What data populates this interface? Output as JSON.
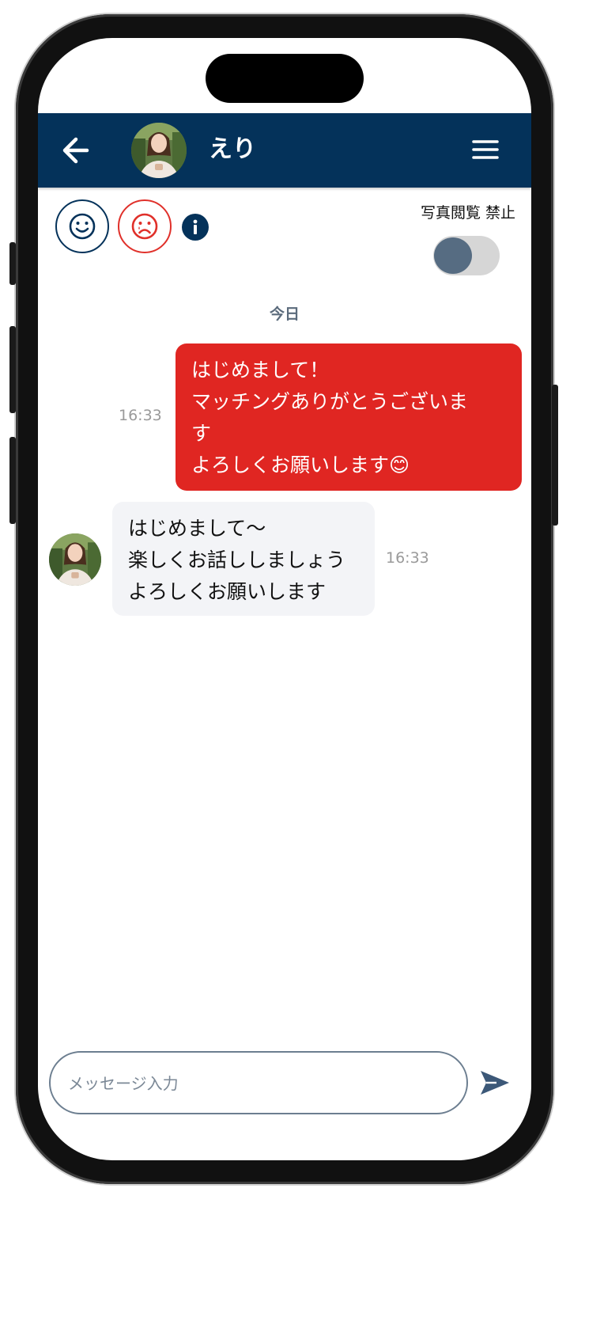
{
  "header": {
    "name": "えり",
    "back_icon": "arrow-left-icon",
    "menu_icon": "hamburger-menu-icon",
    "avatar": "profile-photo"
  },
  "toolbar": {
    "like_icon": "smile-face-icon",
    "dislike_icon": "sad-face-icon",
    "info_icon": "info-icon",
    "photo_view_label": "写真閲覧 禁止",
    "photo_view_forbidden": false
  },
  "chat": {
    "date_separator": "今日",
    "messages": [
      {
        "direction": "outgoing",
        "text": "はじめまして！\nマッチングありがとうございま\nす\nよろしくお願いします😊",
        "time": "16:33"
      },
      {
        "direction": "incoming",
        "text": "はじめまして〜\n楽しくお話ししましょう\nよろしくお願いします",
        "time": "16:33"
      }
    ]
  },
  "composer": {
    "placeholder": "メッセージ入力",
    "value": "",
    "send_icon": "send-icon"
  },
  "colors": {
    "navy": "#04325a",
    "red": "#e02622",
    "incoming_bubble": "#f3f4f7",
    "toggle_knob": "#566c82"
  }
}
